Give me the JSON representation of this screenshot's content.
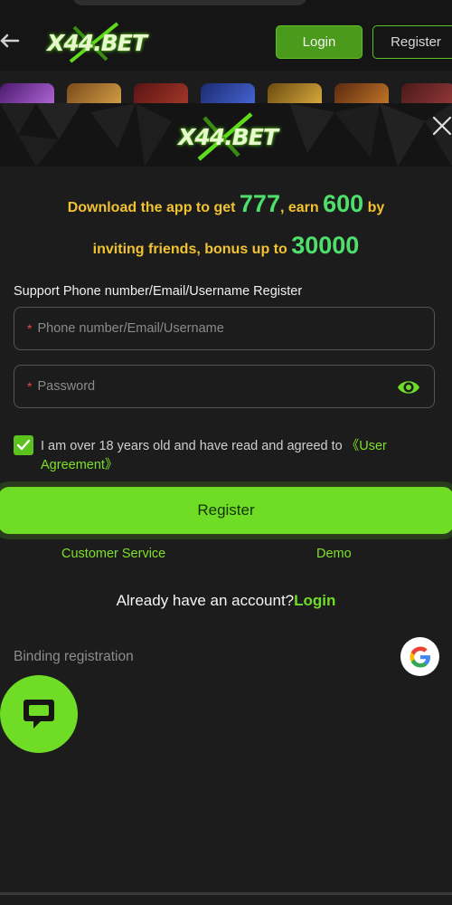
{
  "header": {
    "logo_text": "X44.BET",
    "login_label": "Login",
    "register_label": "Register",
    "back_icon": "back-arrow-icon"
  },
  "modal": {
    "logo_text": "X44.BET",
    "close_icon": "close-icon",
    "promo": {
      "line1_prefix": "Download the app to get ",
      "line1_num1": "777",
      "line1_mid": ", earn ",
      "line1_num2": "600",
      "line1_suffix": " by",
      "line2_prefix": "inviting friends, bonus up to ",
      "line2_num": "30000"
    },
    "register_heading": "Support Phone number/Email/Username Register",
    "username_field": {
      "required_mark": "*",
      "placeholder": "Phone number/Email/Username",
      "value": ""
    },
    "password_field": {
      "required_mark": "*",
      "placeholder": "Password",
      "value": ""
    },
    "agreement": {
      "checked": true,
      "text": "I am over 18 years old and have read and agreed to ",
      "link_text": "《User Agreement》"
    },
    "register_button": "Register",
    "customer_service_link": "Customer Service",
    "demo_link": "Demo",
    "have_account_text": "Already have an account?",
    "login_link": "Login",
    "binding_label": "Binding registration",
    "google_icon": "google-icon",
    "chat_icon": "chat-bubble-icon"
  },
  "colors": {
    "accent_green": "#6fdc26",
    "promo_yellow": "#f1c232",
    "promo_number_green": "#4ee06b",
    "background": "#1c1c1c"
  }
}
